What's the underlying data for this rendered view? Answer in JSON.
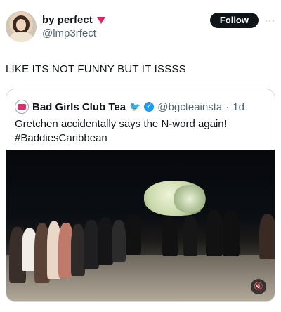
{
  "post": {
    "display_name": "by perfect",
    "handle": "@lmp3rfect",
    "follow_label": "Follow",
    "more_icon": "more-icon",
    "text": "LIKE ITS NOT FUNNY BUT IT ISSSS"
  },
  "quote": {
    "name": "Bad Girls Club Tea",
    "handle": "@bgcteainsta",
    "separator": "·",
    "time": "1d",
    "text_line1": "Gretchen accidentally says the N-word again!",
    "text_line2": "#BaddiesCaribbean",
    "icons": [
      "twitter-bird-icon",
      "verified-icon"
    ]
  },
  "media": {
    "sound_icon": "speaker-muted-icon"
  }
}
